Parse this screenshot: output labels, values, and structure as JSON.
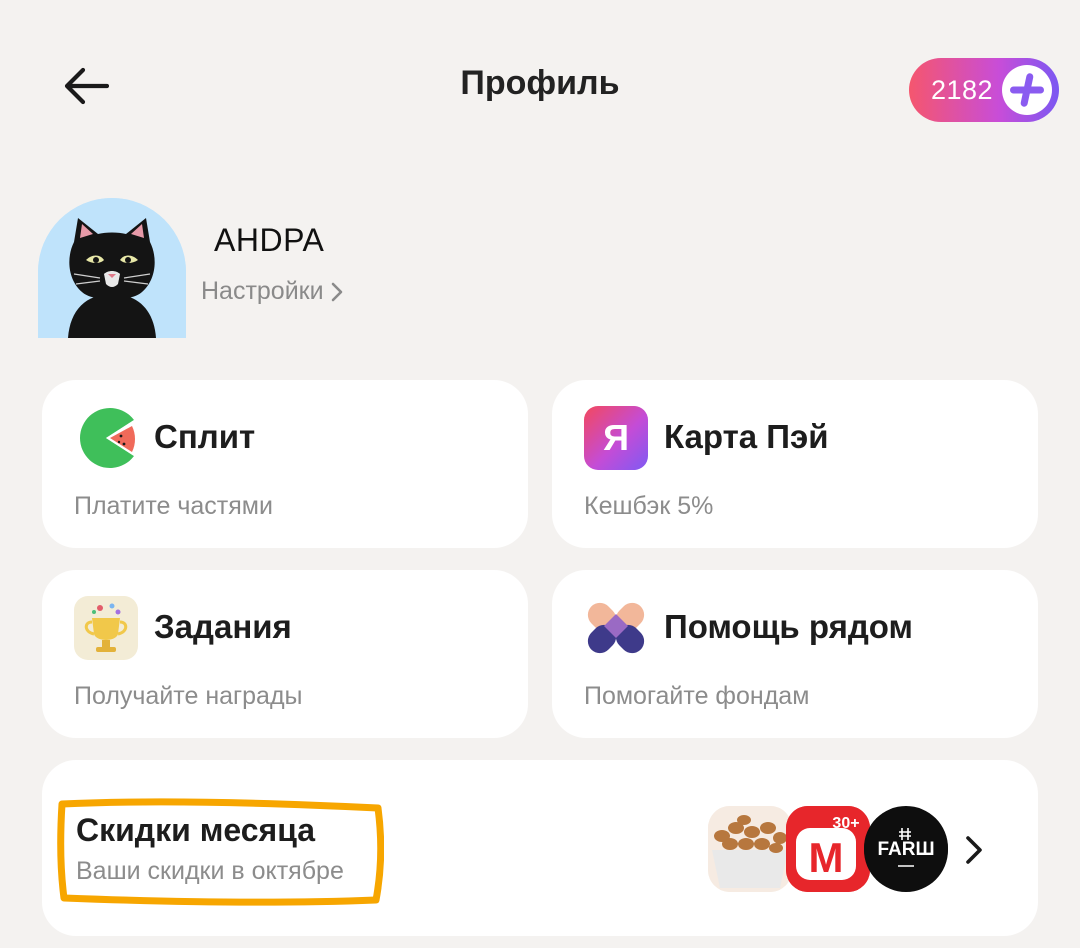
{
  "header": {
    "title": "Профиль",
    "plus_points": "2182"
  },
  "user": {
    "name": "AHDPA",
    "settings_label": "Настройки"
  },
  "cards": [
    {
      "title": "Сплит",
      "subtitle": "Платите частями",
      "icon": "split-pacman-icon"
    },
    {
      "title": "Карта Пэй",
      "subtitle": "Кешбэк 5%",
      "icon": "yandex-pay-card-icon",
      "icon_letter": "Я"
    },
    {
      "title": "Задания",
      "subtitle": "Получайте награды",
      "icon": "trophy-icon"
    },
    {
      "title": "Помощь рядом",
      "subtitle": "Помогайте фондам",
      "icon": "help-nearby-icon"
    }
  ],
  "discounts": {
    "title": "Скидки месяца",
    "subtitle": "Ваши скидки в октябре",
    "stores": [
      {
        "name": "nuts-store-logo"
      },
      {
        "name": "magnit-logo",
        "text": "М",
        "badge": "30+"
      },
      {
        "name": "farsh-logo",
        "text": "FARШ"
      }
    ]
  },
  "colors": {
    "background": "#f4f2f0",
    "card": "#ffffff",
    "highlight": "#f7a600",
    "plus_gradient_start": "#f5566e",
    "plus_gradient_end": "#7b58f2"
  }
}
